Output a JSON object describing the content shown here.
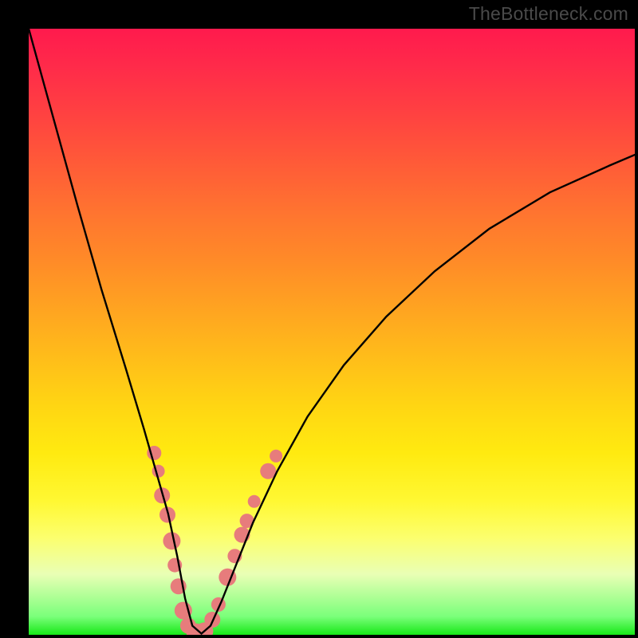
{
  "watermark": "TheBottleneck.com",
  "chart_data": {
    "type": "line",
    "title": "",
    "xlabel": "",
    "ylabel": "",
    "xlim": [
      0,
      1
    ],
    "ylim": [
      0,
      1
    ],
    "notes": "Bottleneck-style V-curve plotted over a vertical red-to-green gradient. Axes are unlabeled (decorative chart). x and y are normalized 0–1 within the plot area; y=0 is the top edge, y=1 is the bottom (green) edge. Pink dot markers cluster near the curve's trough.",
    "series": [
      {
        "name": "bottleneck-curve",
        "x": [
          0.0,
          0.04,
          0.08,
          0.12,
          0.16,
          0.19,
          0.21,
          0.23,
          0.245,
          0.258,
          0.27,
          0.285,
          0.3,
          0.318,
          0.34,
          0.37,
          0.41,
          0.46,
          0.52,
          0.59,
          0.67,
          0.76,
          0.86,
          0.96,
          1.0
        ],
        "y": [
          0.0,
          0.145,
          0.29,
          0.43,
          0.56,
          0.66,
          0.73,
          0.8,
          0.87,
          0.94,
          0.985,
          0.998,
          0.985,
          0.945,
          0.89,
          0.815,
          0.73,
          0.64,
          0.555,
          0.475,
          0.4,
          0.33,
          0.27,
          0.225,
          0.208
        ]
      }
    ],
    "markers": {
      "name": "highlight-dots",
      "color": "#e77c7c",
      "points": [
        {
          "x": 0.207,
          "y": 0.7,
          "r": 9
        },
        {
          "x": 0.214,
          "y": 0.73,
          "r": 8
        },
        {
          "x": 0.22,
          "y": 0.77,
          "r": 10
        },
        {
          "x": 0.229,
          "y": 0.802,
          "r": 10
        },
        {
          "x": 0.236,
          "y": 0.845,
          "r": 11
        },
        {
          "x": 0.241,
          "y": 0.885,
          "r": 9
        },
        {
          "x": 0.247,
          "y": 0.92,
          "r": 10
        },
        {
          "x": 0.255,
          "y": 0.96,
          "r": 11
        },
        {
          "x": 0.263,
          "y": 0.985,
          "r": 10
        },
        {
          "x": 0.276,
          "y": 0.997,
          "r": 12
        },
        {
          "x": 0.29,
          "y": 0.994,
          "r": 11
        },
        {
          "x": 0.303,
          "y": 0.975,
          "r": 10
        },
        {
          "x": 0.313,
          "y": 0.95,
          "r": 9
        },
        {
          "x": 0.328,
          "y": 0.905,
          "r": 11
        },
        {
          "x": 0.34,
          "y": 0.87,
          "r": 9
        },
        {
          "x": 0.352,
          "y": 0.835,
          "r": 10
        },
        {
          "x": 0.36,
          "y": 0.812,
          "r": 9
        },
        {
          "x": 0.372,
          "y": 0.78,
          "r": 8
        },
        {
          "x": 0.395,
          "y": 0.73,
          "r": 10
        },
        {
          "x": 0.408,
          "y": 0.705,
          "r": 8
        }
      ]
    }
  }
}
